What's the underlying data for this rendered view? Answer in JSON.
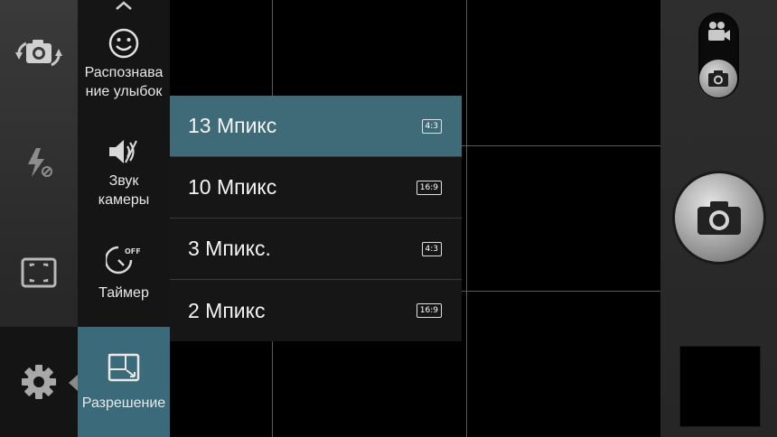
{
  "left_rail": {
    "items": [
      {
        "name": "switch-camera",
        "icon": "switch-camera-icon"
      },
      {
        "name": "flash",
        "icon": "flash-off-icon"
      },
      {
        "name": "focus-mode",
        "icon": "focus-frame-icon"
      },
      {
        "name": "settings",
        "icon": "gear-icon"
      }
    ]
  },
  "settings": {
    "items": [
      {
        "icon": "smile-icon",
        "label": "Распознава\nние улыбок"
      },
      {
        "icon": "speaker-icon",
        "label": "Звук\nкамеры"
      },
      {
        "icon": "timer-off-icon",
        "label": "Таймер"
      },
      {
        "icon": "resolution-icon",
        "label": "Разрешение"
      }
    ]
  },
  "resolution": {
    "options": [
      {
        "label": "13 Мпикс",
        "ratio": "4:3",
        "selected": true
      },
      {
        "label": "10 Мпикс",
        "ratio": "16:9",
        "selected": false
      },
      {
        "label": "3 Мпикс.",
        "ratio": "4:3",
        "selected": false
      },
      {
        "label": "2 Мпикс",
        "ratio": "16:9",
        "selected": false
      }
    ]
  },
  "right_rail": {
    "mode_switch": {
      "selected": "photo",
      "icons": [
        "video-camera-icon",
        "camera-icon"
      ]
    },
    "shutter_icon": "camera-icon"
  },
  "colors": {
    "accent": "#3f6a78",
    "active_setting": "#3b6b7b"
  }
}
